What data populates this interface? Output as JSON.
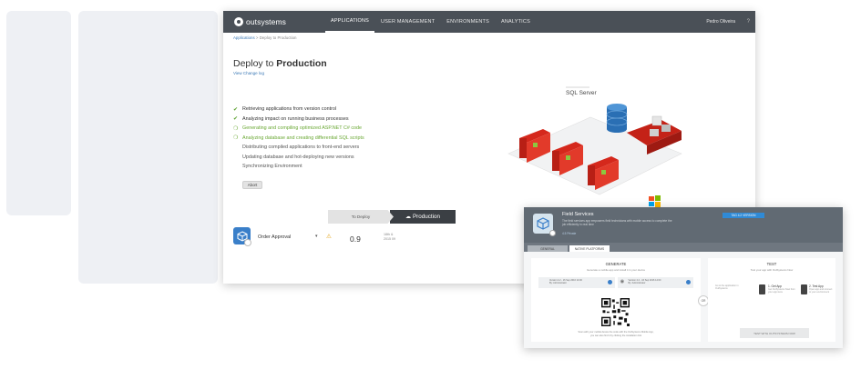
{
  "nav": {
    "logo": "outsystems",
    "tabs": [
      "APPLICATIONS",
      "USER MANAGEMENT",
      "ENVIRONMENTS",
      "ANALYTICS"
    ],
    "user": "Pedro Oliveira",
    "help": "?"
  },
  "breadcrumb": {
    "link": "Applications",
    "separator": " > ",
    "current": "Deploy to Production"
  },
  "page": {
    "title_prefix": "Deploy to ",
    "title_bold": "Production",
    "changelog": "View Change log"
  },
  "steps": [
    {
      "text": "Retrieving applications from version control",
      "state": "done"
    },
    {
      "text": "Analyzing impact on running business processes",
      "state": "done"
    },
    {
      "text": "Generating and compiling optimized ASP.NET C# code",
      "state": "progress"
    },
    {
      "text": "Analyzing database and creating differential SQL scripts",
      "state": "progress"
    },
    {
      "text": "Distributing compiled applications to front-end servers",
      "state": "pending"
    },
    {
      "text": "Updating database and hot-deploying new versions",
      "state": "pending"
    },
    {
      "text": "Synchronizing Environment",
      "state": "pending"
    }
  ],
  "abort_label": "Abort",
  "diagram": {
    "label": "SQL Server"
  },
  "pipeline": {
    "to_deploy": "To Deploy",
    "production": "Production"
  },
  "app": {
    "name": "Order Approval",
    "version": "0.9",
    "date_line1": "18th &",
    "date_line2": "2015 09"
  },
  "field_services": {
    "title": "Field Services",
    "description_line1": "The field services app empowers field technicians with mobile access to complete the",
    "description_line2": "job efficiently in real time",
    "meta": "4.5  Private",
    "header_button": "TAG 4.2 VERSION",
    "tab_general": "GENERAL",
    "tab_native": "NATIVE PLATFORMS",
    "generate_title": "GENERATE",
    "generate_sub": "Generate a mobile app and install it in your device",
    "build_ios": "Version 4.2 - 16 Sep 2016 14:00",
    "build_ios_sub": "By: Administrator",
    "build_android": "Version 4.2 - 16 Sep 2016 14:00",
    "build_android_sub": "By: Administrator",
    "generate_foot1": "Scan with your mobile device the code with the OutSystems Mobile App,",
    "generate_foot2": "you can also find it by clicking the installation link",
    "or": "OR",
    "test_title": "TEST",
    "test_sub": "Test your app with OutSystems Now",
    "step1_title": "1. Get App",
    "step1_desc": "Get OutSystems Now from your app store",
    "step2_title": "2. Test App",
    "step2_desc": "Open app and connect to your environment",
    "test_button": "TEST WITH OUTSYSTEMS NOW",
    "left_desc": "Go to the application in OutSystems"
  },
  "colors": {
    "nav": "#4a5057",
    "accent": "#3a78b5",
    "success": "#5aa02c",
    "warning": "#e3a10f",
    "production": "#3b3f44"
  }
}
